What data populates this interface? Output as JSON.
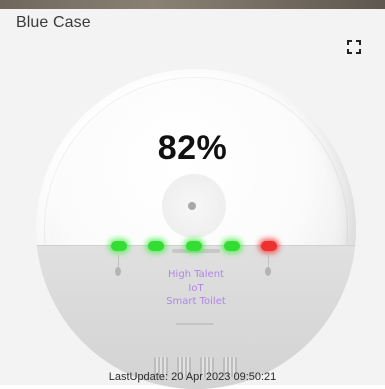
{
  "card": {
    "title": "Blue Case",
    "fullscreen_icon": "fullscreen-icon"
  },
  "device": {
    "fill_level_label": "82%",
    "fill_level": 0.82,
    "brand_lines": [
      "High Talent",
      "IoT",
      "Smart Toilet"
    ],
    "brand_color": "#b086e8",
    "leds": [
      {
        "status": "green",
        "color": "#33dd33"
      },
      {
        "status": "green",
        "color": "#33dd33"
      },
      {
        "status": "green",
        "color": "#33dd33"
      },
      {
        "status": "green",
        "color": "#33dd33"
      },
      {
        "status": "red",
        "color": "#ee3030"
      }
    ]
  },
  "footer": {
    "last_update": "LastUpdate: 20 Apr 2023 09:50:21"
  }
}
